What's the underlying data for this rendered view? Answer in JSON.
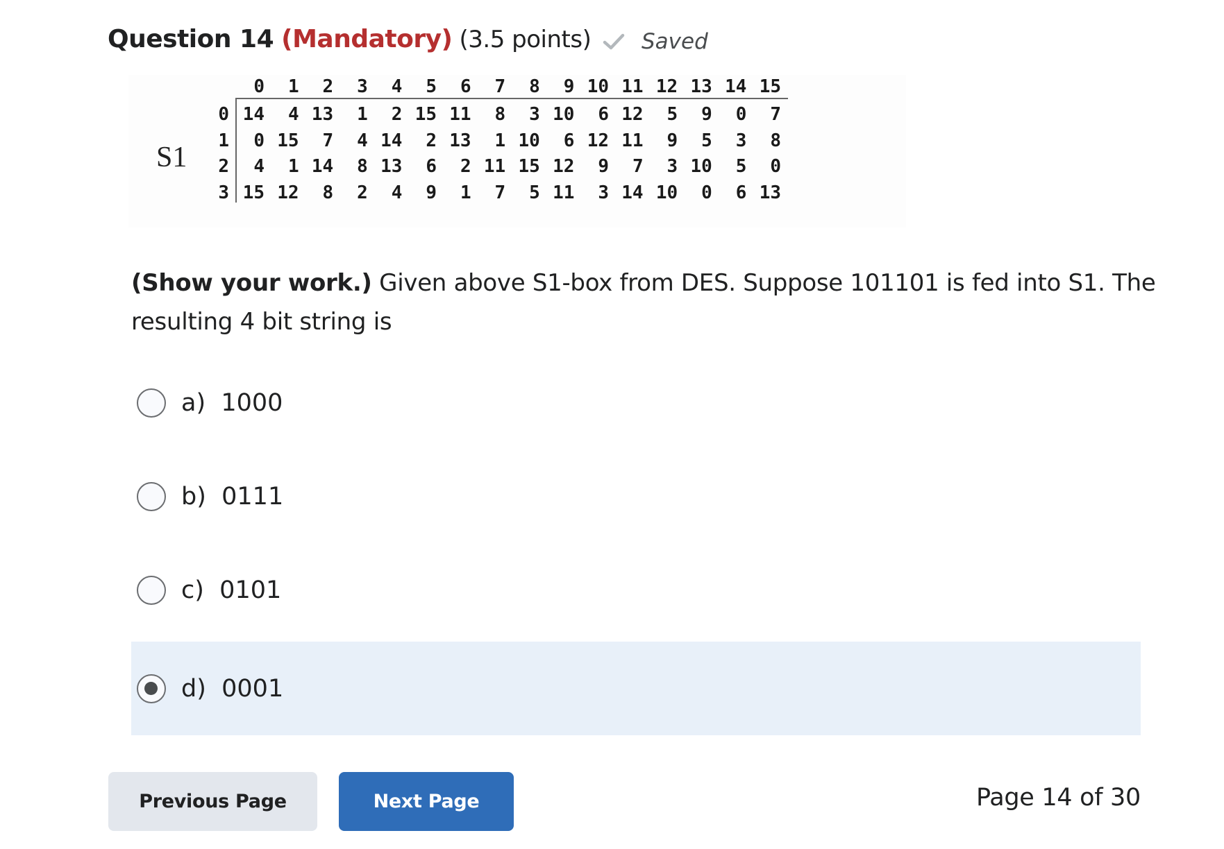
{
  "question": {
    "title": "Question 14",
    "mandatory_label": "(Mandatory)",
    "points_label": "(3.5 points)",
    "saved_status": "Saved",
    "saved_icon": "check-icon",
    "prompt_bold": "(Show your work.)",
    "prompt_text": " Given above S1-box from DES. Suppose 101101 is fed into S1. The resulting 4 bit string is"
  },
  "sbox": {
    "label": "S1",
    "column_headers": [
      "0",
      "1",
      "2",
      "3",
      "4",
      "5",
      "6",
      "7",
      "8",
      "9",
      "10",
      "11",
      "12",
      "13",
      "14",
      "15"
    ],
    "row_headers": [
      "0",
      "1",
      "2",
      "3"
    ],
    "rows": [
      [
        "14",
        "4",
        "13",
        "1",
        "2",
        "15",
        "11",
        "8",
        "3",
        "10",
        "6",
        "12",
        "5",
        "9",
        "0",
        "7"
      ],
      [
        "0",
        "15",
        "7",
        "4",
        "14",
        "2",
        "13",
        "1",
        "10",
        "6",
        "12",
        "11",
        "9",
        "5",
        "3",
        "8"
      ],
      [
        "4",
        "1",
        "14",
        "8",
        "13",
        "6",
        "2",
        "11",
        "15",
        "12",
        "9",
        "7",
        "3",
        "10",
        "5",
        "0"
      ],
      [
        "15",
        "12",
        "8",
        "2",
        "4",
        "9",
        "1",
        "7",
        "5",
        "11",
        "3",
        "14",
        "10",
        "0",
        "6",
        "13"
      ]
    ]
  },
  "options": [
    {
      "letter": "a)",
      "value": "1000",
      "selected": false
    },
    {
      "letter": "b)",
      "value": "0111",
      "selected": false
    },
    {
      "letter": "c)",
      "value": "0101",
      "selected": false
    },
    {
      "letter": "d)",
      "value": "0001",
      "selected": true
    }
  ],
  "footer": {
    "previous_label": "Previous Page",
    "next_label": "Next Page",
    "page_indicator": "Page 14 of 30"
  },
  "colors": {
    "mandatory": "#b52f2f",
    "primary_button": "#2f6db8",
    "secondary_button": "#e3e7ed",
    "selected_row": "#e8f0f9"
  }
}
